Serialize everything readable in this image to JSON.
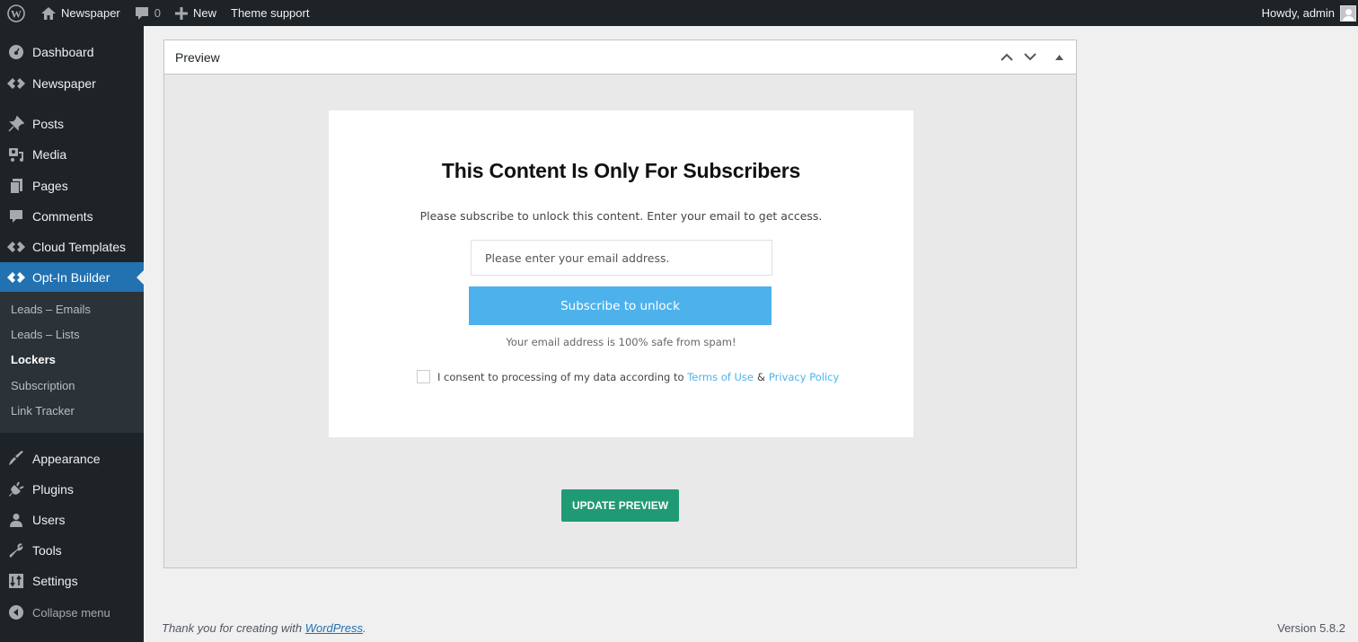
{
  "adminbar": {
    "site_name": "Newspaper",
    "comments_count": "0",
    "new_label": "New",
    "theme_support_label": "Theme support",
    "greeting": "Howdy, admin"
  },
  "sidebar": {
    "items": [
      {
        "label": "Dashboard",
        "icon": "dashboard-icon"
      },
      {
        "label": "Newspaper",
        "icon": "newspaper-icon"
      },
      {
        "label": "Posts",
        "icon": "pin-icon"
      },
      {
        "label": "Media",
        "icon": "media-icon"
      },
      {
        "label": "Pages",
        "icon": "pages-icon"
      },
      {
        "label": "Comments",
        "icon": "comment-icon"
      },
      {
        "label": "Cloud Templates",
        "icon": "cloud-templates-icon"
      },
      {
        "label": "Opt-In Builder",
        "icon": "optin-builder-icon"
      },
      {
        "label": "Appearance",
        "icon": "brush-icon"
      },
      {
        "label": "Plugins",
        "icon": "plug-icon"
      },
      {
        "label": "Users",
        "icon": "user-icon"
      },
      {
        "label": "Tools",
        "icon": "wrench-icon"
      },
      {
        "label": "Settings",
        "icon": "settings-icon"
      }
    ],
    "submenu": [
      {
        "label": "Leads – Emails"
      },
      {
        "label": "Leads – Lists"
      },
      {
        "label": "Lockers",
        "current": true
      },
      {
        "label": "Subscription"
      },
      {
        "label": "Link Tracker"
      }
    ],
    "collapse_label": "Collapse menu"
  },
  "postbox": {
    "title": "Preview",
    "locker": {
      "title": "This Content Is Only For Subscribers",
      "description": "Please subscribe to unlock this content. Enter your email to get access.",
      "email_placeholder": "Please enter your email address.",
      "email_value": "",
      "subscribe_label": "Subscribe to unlock",
      "spam_note": "Your email address is 100% safe from spam!",
      "consent_text": "I consent to processing of my data according to",
      "terms_label": "Terms of Use",
      "amp": "&",
      "privacy_label": "Privacy Policy",
      "consent_checked": false
    },
    "update_label": "UPDATE PREVIEW"
  },
  "footer": {
    "thanks_text": "Thank you for creating with",
    "wordpress_link": "WordPress",
    "period": ".",
    "version": "Version 5.8.2"
  },
  "colors": {
    "admin_dark": "#1d2327",
    "accent_blue": "#2271b1",
    "subscribe_blue": "#4db2ec",
    "update_green": "#1f9a74"
  }
}
